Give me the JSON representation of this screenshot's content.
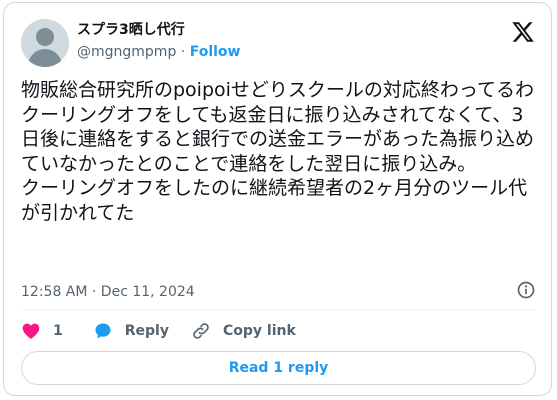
{
  "post": {
    "display_name": "スプラ3晒し代行",
    "handle": "@mgngmpmp",
    "separator": "·",
    "follow_label": "Follow",
    "text": "物販総合研究所のpoipoiせどりスクールの対応終わってるわ\nクーリングオフをしても返金日に振り込みされてなくて、3日後に連絡をすると銀行での送金エラーがあった為振り込めていなかったとのことで連絡をした翌日に振り込み。\nクーリングオフをしたのに継続希望者の2ヶ月分のツール代が引かれてた",
    "timestamp": "12:58 AM · Dec 11, 2024"
  },
  "actions": {
    "like_count": "1",
    "reply_label": "Reply",
    "copy_link_label": "Copy link",
    "read_reply_label": "Read 1 reply"
  },
  "icons": {
    "brand": "x-logo-icon",
    "info": "info-icon",
    "like": "heart-icon",
    "reply": "speech-bubble-icon",
    "copy": "link-icon"
  },
  "colors": {
    "accent": "#1d9bf0",
    "like": "#f91880",
    "secondary_text": "#536471",
    "border": "#cfd9de"
  }
}
